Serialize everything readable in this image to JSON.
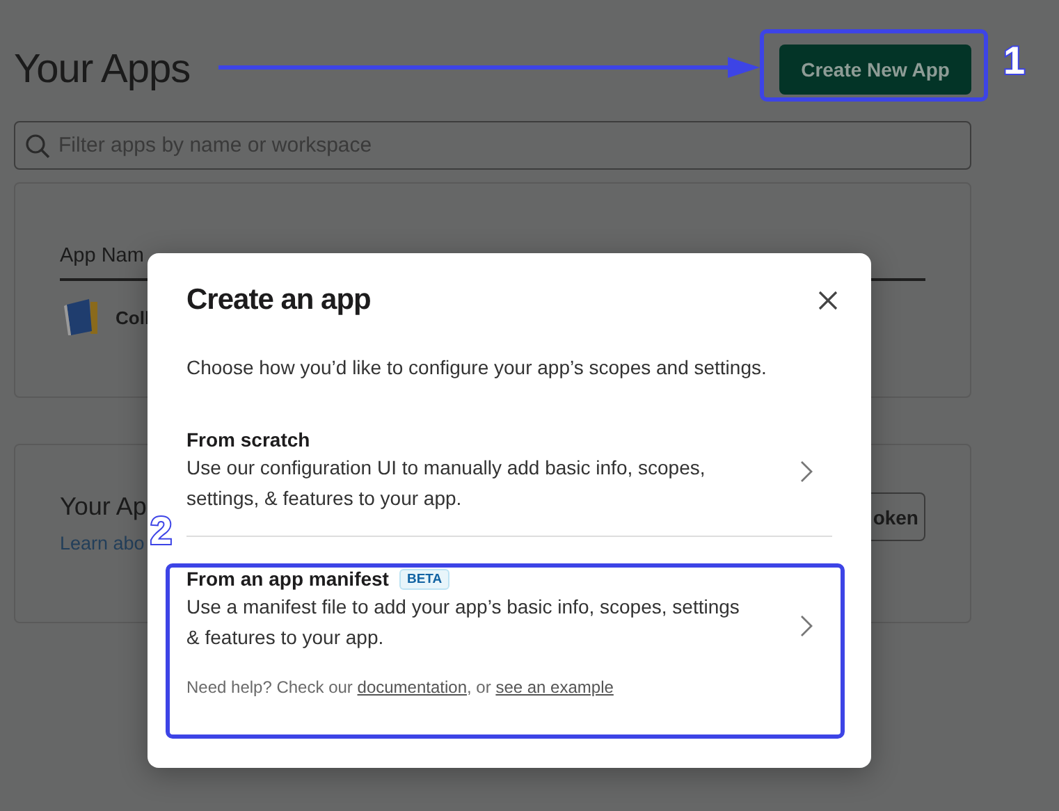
{
  "page": {
    "title": "Your Apps",
    "create_button": "Create New App",
    "filter": {
      "placeholder": "Filter apps by name or workspace"
    },
    "apps_table": {
      "columns": [
        "App Nam"
      ],
      "rows": [
        {
          "app_name": "Coll"
        }
      ]
    },
    "tokens_card": {
      "title": "Your Ap",
      "link": "Learn abo",
      "button": "oken"
    }
  },
  "modal": {
    "title": "Create an app",
    "subtitle": "Choose how you’d like to configure your app’s scopes and settings.",
    "options": [
      {
        "title": "From scratch",
        "description": "Use our configuration UI to manually add basic info, scopes, settings, & features to your app."
      },
      {
        "title": "From an app manifest",
        "badge": "BETA",
        "description": "Use a manifest file to add your app’s basic info, scopes, settings & features to your app.",
        "help": {
          "text": "Need help? Check our",
          "link_1": "documentation",
          "separator": ", or",
          "link_2": "see an example"
        }
      }
    ]
  },
  "callouts": [
    {
      "number": "1"
    },
    {
      "number": "2"
    }
  ]
}
